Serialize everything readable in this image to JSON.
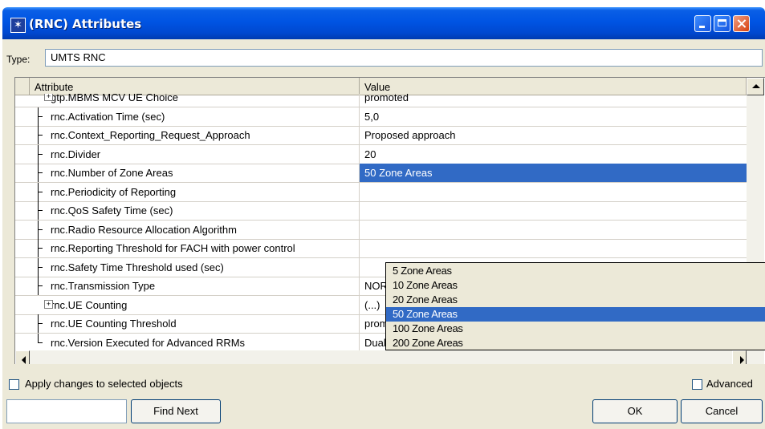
{
  "window": {
    "title": "(RNC) Attributes",
    "icon": "star-icon"
  },
  "type_field": {
    "label": "Type:",
    "value": "UMTS RNC"
  },
  "table": {
    "columns": [
      "Attribute",
      "Value"
    ],
    "rows": [
      {
        "attribute": "gtp.MBMS MCV UE Choice",
        "value": "promoted",
        "kind": "expand",
        "partial": true
      },
      {
        "attribute": "rnc.Activation Time (sec)",
        "value": "5,0",
        "kind": "branch"
      },
      {
        "attribute": "rnc.Context_Reporting_Request_Approach",
        "value": "Proposed approach",
        "kind": "branch"
      },
      {
        "attribute": "rnc.Divider",
        "value": "20",
        "kind": "branch"
      },
      {
        "attribute": "rnc.Number of Zone Areas",
        "value": "50 Zone Areas",
        "kind": "branch",
        "selected": true
      },
      {
        "attribute": "rnc.Periodicity of Reporting",
        "value": "",
        "kind": "branch"
      },
      {
        "attribute": "rnc.QoS Safety Time (sec)",
        "value": "",
        "kind": "branch"
      },
      {
        "attribute": "rnc.Radio Resource Allocation Algorithm",
        "value": "",
        "kind": "branch"
      },
      {
        "attribute": "rnc.Reporting Threshold for FACH with power control",
        "value": "",
        "kind": "branch"
      },
      {
        "attribute": "rnc.Safety Time Threshold used (sec)",
        "value": "",
        "kind": "branch"
      },
      {
        "attribute": "rnc.Transmission Type",
        "value": "NORMAL_MODE",
        "kind": "branch"
      },
      {
        "attribute": "rnc.UE Counting",
        "value": "(...)",
        "kind": "expand"
      },
      {
        "attribute": "rnc.UE Counting Threshold",
        "value": "promoted",
        "kind": "branch"
      },
      {
        "attribute": "rnc.Version Executed for Advanced RRMs",
        "value": "Dual Transmission",
        "kind": "last"
      }
    ]
  },
  "dropdown": {
    "options": [
      "5 Zone Areas",
      "10 Zone Areas",
      "20 Zone Areas",
      "50 Zone Areas",
      "100 Zone Areas",
      "200 Zone Areas"
    ],
    "selected": "50 Zone Areas"
  },
  "footer": {
    "apply_label": "Apply changes to selected objects",
    "advanced_label": "Advanced",
    "find_value": "",
    "find_next_label": "Find Next",
    "ok_label": "OK",
    "cancel_label": "Cancel"
  },
  "colors": {
    "title_bar": "#0054e3",
    "selection": "#316ac5",
    "dialog_bg": "#ece9d8"
  }
}
